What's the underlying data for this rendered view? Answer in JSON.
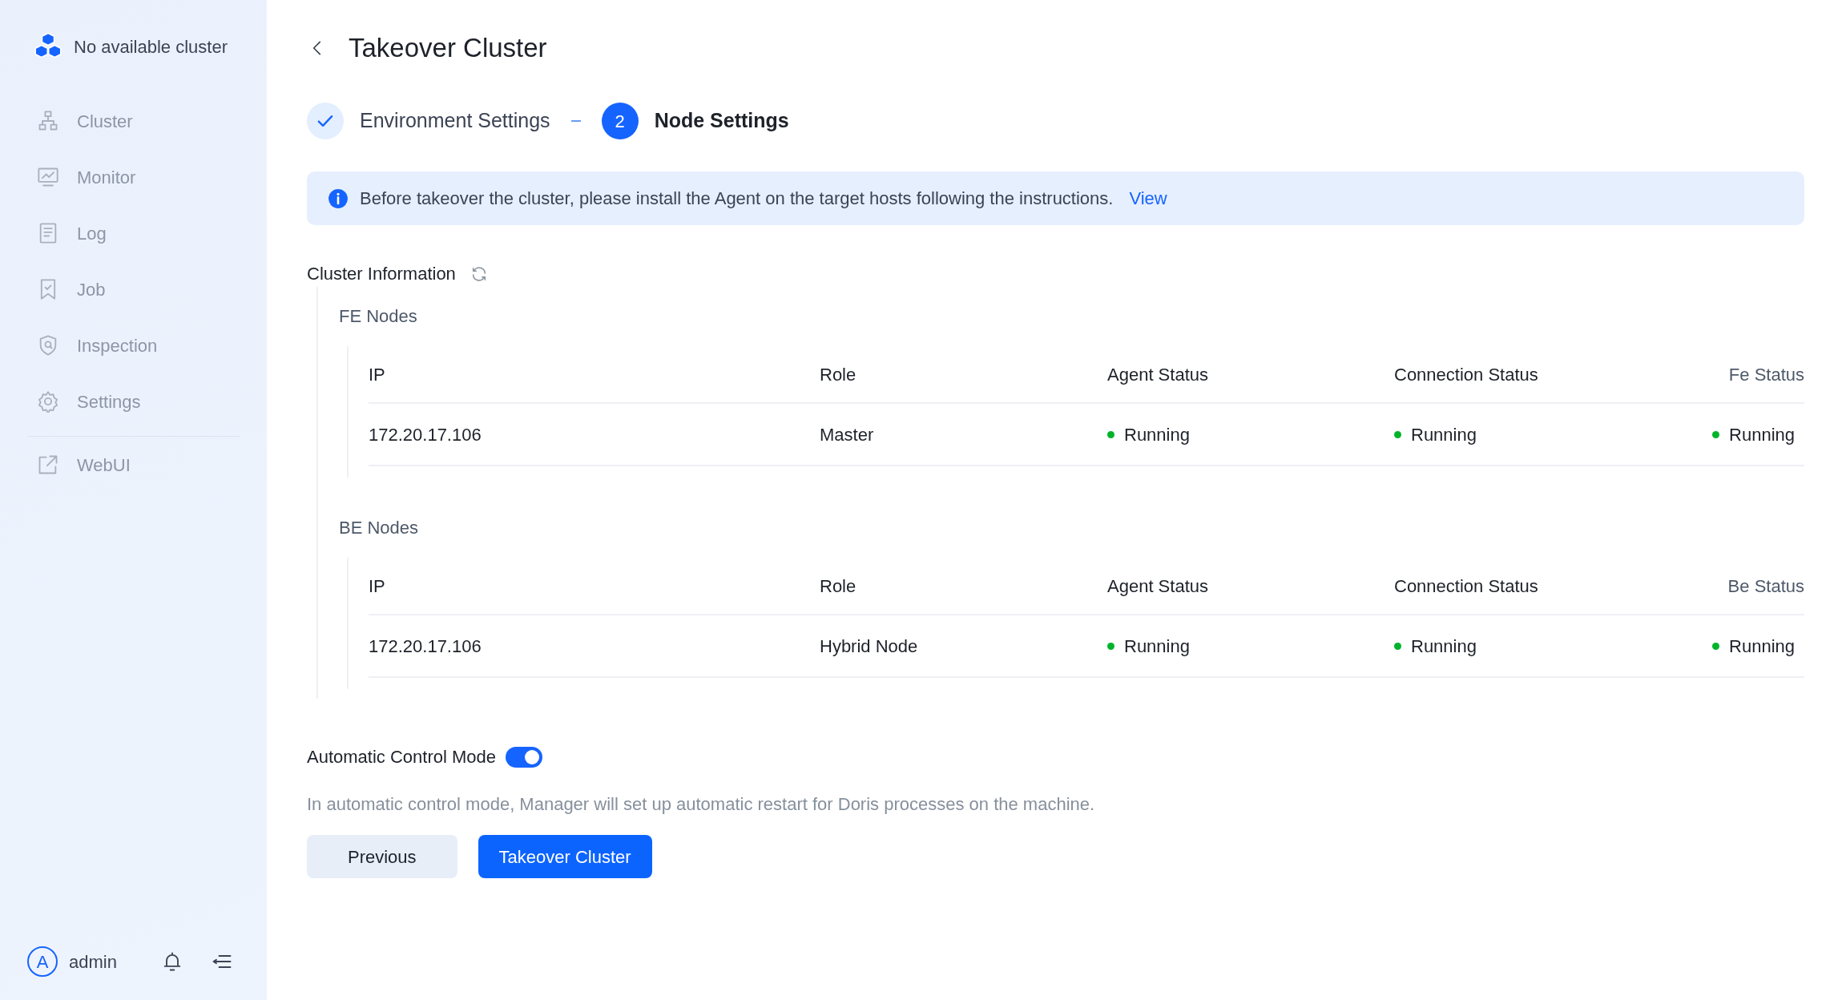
{
  "sidebar": {
    "brand": "No available cluster",
    "items": [
      {
        "label": "Cluster",
        "kind": "cluster",
        "disabled": true
      },
      {
        "label": "Monitor",
        "kind": "monitor",
        "disabled": true
      },
      {
        "label": "Log",
        "kind": "log",
        "disabled": true
      },
      {
        "label": "Job",
        "kind": "job",
        "disabled": true
      },
      {
        "label": "Inspection",
        "kind": "inspection",
        "disabled": true
      },
      {
        "label": "Settings",
        "kind": "settings",
        "disabled": true
      }
    ],
    "external_items": [
      {
        "label": "WebUI",
        "kind": "external",
        "disabled": true
      }
    ],
    "user": {
      "initial": "A",
      "name": "admin"
    }
  },
  "page": {
    "title": "Takeover Cluster"
  },
  "steps": [
    {
      "label": "Environment Settings",
      "completed": true,
      "selected": false
    },
    {
      "label": "Node Settings",
      "number": "2",
      "completed": false,
      "selected": true
    }
  ],
  "alert": {
    "text": "Before takeover the cluster, please install the Agent on the target hosts following the instructions.",
    "link": "View"
  },
  "cluster_info": {
    "title": "Cluster Information",
    "groups": [
      {
        "title": "FE Nodes",
        "columns": [
          "IP",
          "Role",
          "Agent Status",
          "Connection Status",
          "Fe Status"
        ],
        "rows": [
          {
            "cells": [
              {
                "text": "172.20.17.106"
              },
              {
                "text": "Master"
              },
              {
                "text": "Running",
                "color": "#00b42a"
              },
              {
                "text": "Running",
                "color": "#00b42a"
              },
              {
                "text": "Running",
                "color": "#00b42a"
              }
            ]
          }
        ]
      },
      {
        "title": "BE Nodes",
        "columns": [
          "IP",
          "Role",
          "Agent Status",
          "Connection Status",
          "Be Status"
        ],
        "rows": [
          {
            "cells": [
              {
                "text": "172.20.17.106"
              },
              {
                "text": "Hybrid Node"
              },
              {
                "text": "Running",
                "color": "#00b42a"
              },
              {
                "text": "Running",
                "color": "#00b42a"
              },
              {
                "text": "Running",
                "color": "#00b42a"
              }
            ]
          }
        ]
      }
    ]
  },
  "auto_control": {
    "label": "Automatic Control Mode",
    "on": true,
    "description": "In automatic control mode, Manager will set up automatic restart for Doris processes on the machine."
  },
  "buttons": [
    {
      "label": "Previous",
      "kind": "secondary"
    },
    {
      "label": "Takeover Cluster",
      "kind": "primary"
    }
  ]
}
